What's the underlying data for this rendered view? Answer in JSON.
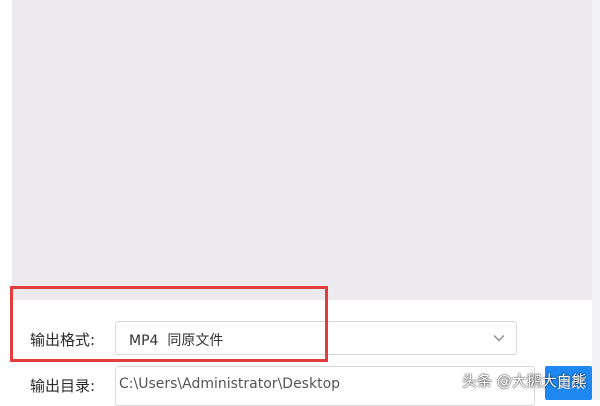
{
  "output_format": {
    "label": "输出格式:",
    "value": "MP4  同原文件"
  },
  "output_dir": {
    "label": "输出目录:",
    "value": "C:\\Users\\Administrator\\Desktop"
  },
  "change_button": {
    "label": "更改"
  },
  "watermark": {
    "text": "头条 @大鹅大白熊"
  },
  "colors": {
    "highlight": "#e23c3c",
    "accent": "#1e88f0"
  }
}
